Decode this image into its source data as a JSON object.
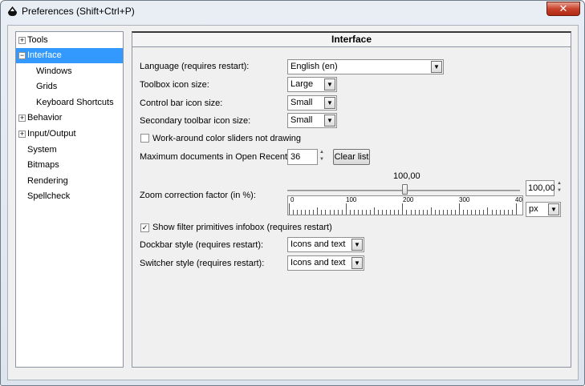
{
  "window": {
    "title": "Preferences (Shift+Ctrl+P)",
    "close_label": "✕"
  },
  "tree": {
    "items": [
      {
        "label": "Tools",
        "expander": "+"
      },
      {
        "label": "Interface",
        "expander": "−"
      },
      {
        "label": "Windows"
      },
      {
        "label": "Grids"
      },
      {
        "label": "Keyboard Shortcuts"
      },
      {
        "label": "Behavior",
        "expander": "+"
      },
      {
        "label": "Input/Output",
        "expander": "+"
      },
      {
        "label": "System"
      },
      {
        "label": "Bitmaps"
      },
      {
        "label": "Rendering"
      },
      {
        "label": "Spellcheck"
      }
    ],
    "selected": "Interface"
  },
  "panel": {
    "title": "Interface",
    "language": {
      "label": "Language (requires restart):",
      "value": "English (en)"
    },
    "toolbox_icon": {
      "label": "Toolbox icon size:",
      "value": "Large"
    },
    "control_bar_icon": {
      "label": "Control bar icon size:",
      "value": "Small"
    },
    "secondary_toolbar_icon": {
      "label": "Secondary toolbar icon size:",
      "value": "Small"
    },
    "workaround_color": {
      "label": "Work-around color sliders not drawing",
      "checked": false
    },
    "max_docs": {
      "label": "Maximum documents in Open Recent:",
      "value": "36",
      "clear_label": "Clear list"
    },
    "zoom": {
      "label": "Zoom correction factor (in %):",
      "slider_value": "100,00",
      "spin_value": "100,00",
      "unit": "px",
      "ruler_labels": [
        "0",
        "100",
        "200",
        "300",
        "40"
      ]
    },
    "filter_primitives": {
      "label": "Show filter primitives infobox (requires restart)",
      "checked": true
    },
    "dockbar_style": {
      "label": "Dockbar style (requires restart):",
      "value": "Icons and text"
    },
    "switcher_style": {
      "label": "Switcher style (requires restart):",
      "value": "Icons and text"
    }
  },
  "icons": {
    "checkmark": "✓",
    "dropdown": "▼",
    "spin_up": "▲",
    "spin_down": "▼"
  },
  "colors": {
    "selection": "#3399ff",
    "close_button": "#c8432c"
  }
}
